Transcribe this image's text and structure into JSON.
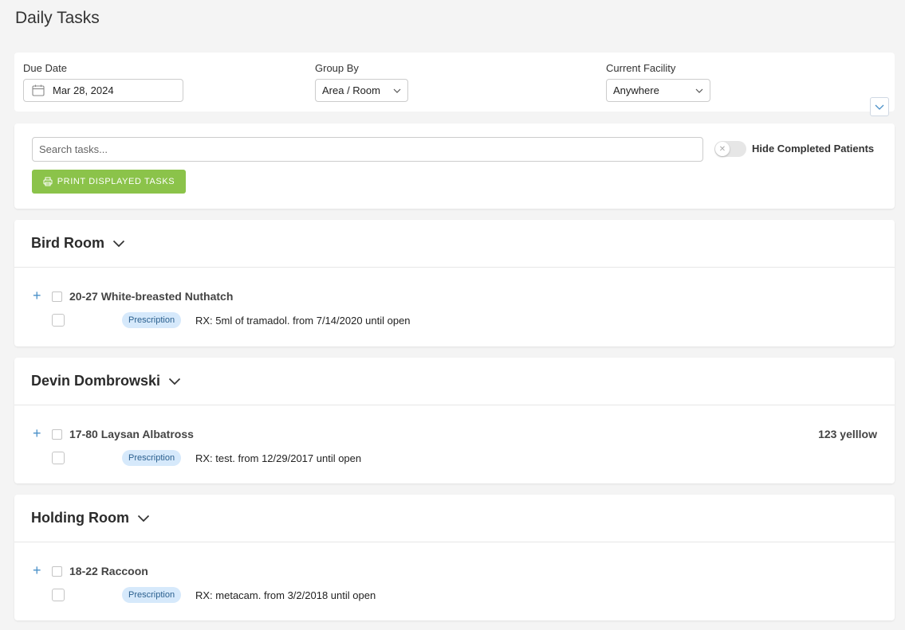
{
  "page": {
    "title": "Daily Tasks"
  },
  "filters": {
    "due_date": {
      "label": "Due Date",
      "value": "Mar 28, 2024"
    },
    "group_by": {
      "label": "Group By",
      "value": "Area / Room"
    },
    "facility": {
      "label": "Current Facility",
      "value": "Anywhere"
    }
  },
  "search": {
    "placeholder": "Search tasks...",
    "hide_completed_label": "Hide Completed Patients",
    "print_label": "PRINT DISPLAYED TASKS"
  },
  "colors": {
    "accent_green": "#8bc34a",
    "link_blue": "#4a90c8",
    "tag_bg": "#d6e9fb"
  },
  "groups": [
    {
      "title": "Bird Room",
      "patient": "20-27 White-breasted Nuthatch",
      "note": "",
      "tag": "Prescription",
      "task": "RX: 5ml of tramadol. from 7/14/2020 until open"
    },
    {
      "title": "Devin Dombrowski",
      "patient": "17-80 Laysan Albatross",
      "note": "123 yelllow",
      "tag": "Prescription",
      "task": "RX: test. from 12/29/2017 until open"
    },
    {
      "title": "Holding Room",
      "patient": "18-22 Raccoon",
      "note": "",
      "tag": "Prescription",
      "task": "RX: metacam. from 3/2/2018 until open"
    }
  ]
}
